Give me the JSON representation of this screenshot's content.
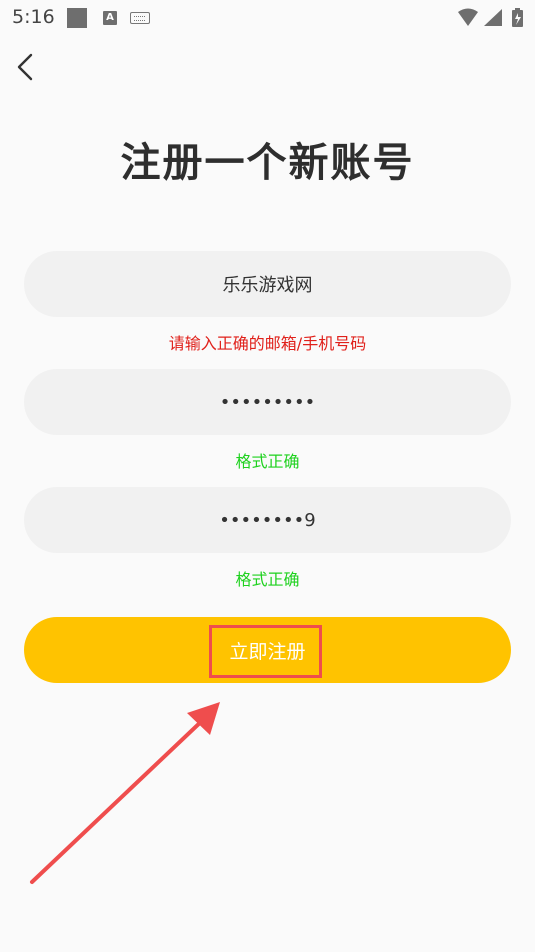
{
  "status_bar": {
    "time": "5:16",
    "icons": [
      "square-icon",
      "a-icon",
      "keyboard-icon",
      "wifi-icon",
      "signal-icon",
      "battery-icon"
    ]
  },
  "header": {
    "back_icon": "chevron-left-icon",
    "title": "注册一个新账号"
  },
  "form": {
    "username": {
      "value": "乐乐游戏网",
      "hint": "请输入正确的邮箱/手机号码"
    },
    "password": {
      "value": "•••••••••",
      "hint": "格式正确"
    },
    "confirm_password": {
      "value": "••••••••9",
      "hint": "格式正确"
    },
    "submit_label": "立即注册"
  },
  "colors": {
    "accent": "#ffc300",
    "error": "#e0201a",
    "success": "#1ed11e",
    "annotation": "#ef4d4d"
  }
}
